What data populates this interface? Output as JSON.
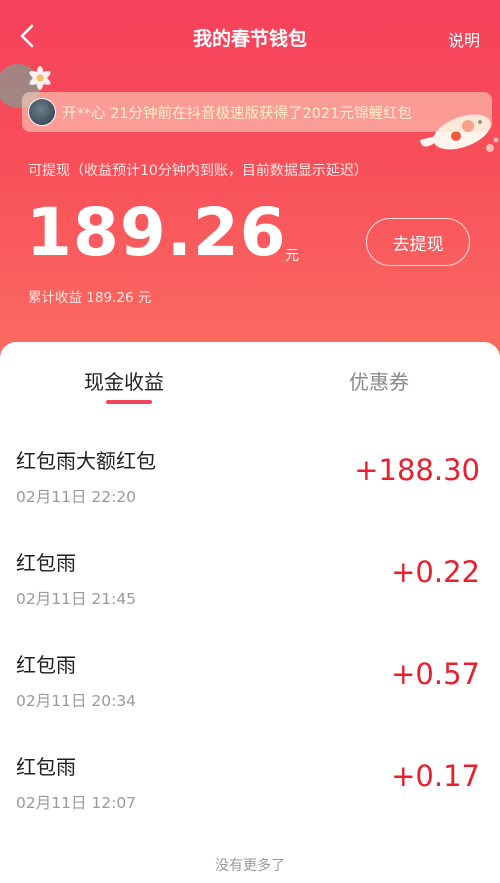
{
  "header": {
    "title": "我的春节钱包",
    "help_label": "说明",
    "ticker": "开**心 21分钟前在抖音极速版获得了2021元锦鲤红包",
    "withdraw_label": "可提现（收益预计10分钟内到账，目前数据显示延迟）",
    "balance": "189.26",
    "balance_unit": "元",
    "withdraw_button": "去提现",
    "total_earnings": "累计收益 189.26 元"
  },
  "tabs": [
    {
      "label": "现金收益",
      "active": true
    },
    {
      "label": "优惠券",
      "active": false
    }
  ],
  "records": [
    {
      "title": "红包雨大额红包",
      "time": "02月11日 22:20",
      "amount": "+188.30"
    },
    {
      "title": "红包雨",
      "time": "02月11日 21:45",
      "amount": "+0.22"
    },
    {
      "title": "红包雨",
      "time": "02月11日 20:34",
      "amount": "+0.57"
    },
    {
      "title": "红包雨",
      "time": "02月11日 12:07",
      "amount": "+0.17"
    }
  ],
  "footer": "没有更多了",
  "icons": [
    "back-arrow-icon",
    "flower-icon",
    "koi-fish-icon",
    "avatar"
  ],
  "colors": {
    "header_red": "#f6415b",
    "amount_red": "#e8202e",
    "tab_indicator": "#f2465b"
  }
}
